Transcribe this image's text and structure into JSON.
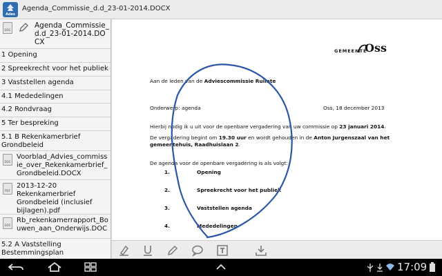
{
  "titlebar": {
    "title": "Agenda_Commissie_d.d_23-01-2014.DOCX",
    "logo_subtext": "Ades"
  },
  "sidebar": {
    "header_label": "Agenda_Commissie_d.d_23-01-2014.DOCX",
    "items": [
      {
        "label": "1 Opening"
      },
      {
        "label": "2 Spreekrecht voor het publiek"
      },
      {
        "label": "3 Vaststellen agenda"
      },
      {
        "label": "4.1 Mededelingen"
      },
      {
        "label": "4.2 Rondvraag"
      },
      {
        "label": "5 Ter bespreking"
      },
      {
        "label": "5.1 B  Rekenkamerbrief Grondbeleid"
      },
      {
        "label": "Voorblad_Advies_commissie_over_Rekenkamerbrief_Grondbeleid.DOCX",
        "icon": "doc-file-icon"
      },
      {
        "label": "2013-12-20 Rekenkamerbrief Grondbeleid (inclusief bijlagen).pdf",
        "icon": "pdf-file-icon"
      },
      {
        "label": "Rb_rekenkamerrapport_Bouwen_aan_Onderwijs.DOC",
        "icon": "doc-file-icon"
      },
      {
        "label": "5.2 A  Vaststelling Bestemmingsplan"
      }
    ]
  },
  "document": {
    "logo_text": "GEMEENTE",
    "logo_name": "Oss",
    "addressee_prefix": "Aan de leden van de ",
    "addressee_bold": "Adviescommissie Ruimte",
    "subject": "Onderwerp: agenda",
    "place_date": "Oss, 18 december 2013",
    "p1_a": "Hierbij nodig ik u uit voor de openbare vergadering van uw commissie op ",
    "p1_b": "23 januari 2014",
    "p1_c": ".",
    "p2_a": "De vergadering begint om ",
    "p2_b": "19.30 uur",
    "p2_c": " en wordt gehouden in de ",
    "p2_d": "Anton Jurgenszaal van het",
    "p3_a": "gemeentehuis, Raadhuislaan 2",
    "p3_b": ".",
    "p4": "De agenda voor de openbare vergadering is als volgt:",
    "agenda": [
      {
        "num": "1.",
        "label": "Opening"
      },
      {
        "num": "2.",
        "label": "Spreekrecht voor het publiek"
      },
      {
        "num": "3.",
        "label": "Vaststellen agenda"
      },
      {
        "num": "4.",
        "label": "Mededelingen"
      }
    ],
    "ink_color": "#2a56a8"
  },
  "toolbar": {
    "tools": [
      "highlight-icon",
      "underline-icon",
      "pencil-icon",
      "comment-icon",
      "text-icon",
      "save-icon"
    ]
  },
  "systembar": {
    "time": "17:09"
  }
}
